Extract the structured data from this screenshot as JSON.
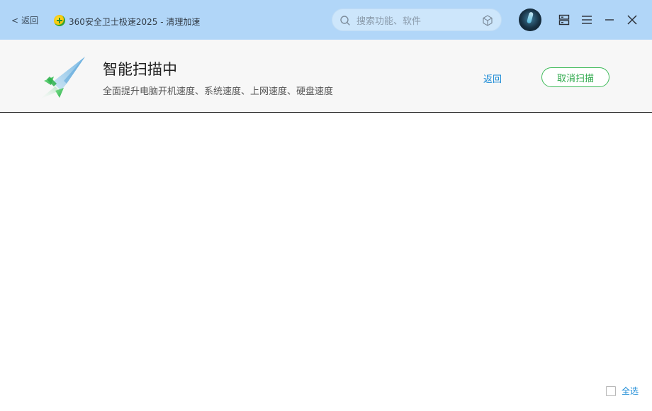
{
  "titlebar": {
    "back_label": "返回",
    "back_chevron": "<",
    "app_title": "360安全卫士极速2025 - 清理加速",
    "search_placeholder": "搜索功能、软件",
    "icons": {
      "logo": "360-logo-icon",
      "search": "search-icon",
      "cube": "cube-icon",
      "server": "server-icon",
      "menu": "hamburger-menu-icon",
      "minimize": "minimize-icon",
      "close": "close-icon"
    },
    "background_color": "#b1d6f8"
  },
  "header": {
    "title": "智能扫描中",
    "subtitle": "全面提升电脑开机速度、系统速度、上网速度、硬盘速度",
    "return_label": "返回",
    "cancel_label": "取消扫描",
    "accent_green": "#3fbb5a",
    "link_blue": "#1a8ad6",
    "rocket_icon": "rocket-icon"
  },
  "footer": {
    "select_all_label": "全选",
    "select_all_checked": false
  }
}
